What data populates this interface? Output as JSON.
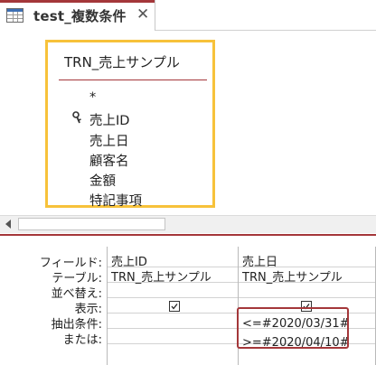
{
  "tab": {
    "title": "test_複数条件",
    "close_glyph": "✕"
  },
  "diagram": {
    "table_name": "TRN_売上サンプル",
    "fields": [
      "*",
      "売上ID",
      "売上日",
      "顧客名",
      "金額",
      "特記事項"
    ]
  },
  "grid": {
    "row_labels": [
      "フィールド:",
      "テーブル:",
      "並べ替え:",
      "表示:",
      "抽出条件:",
      "または:"
    ],
    "columns": [
      {
        "field": "売上ID",
        "table": "TRN_売上サンプル",
        "sort": "",
        "show": true,
        "criteria": "",
        "or": ""
      },
      {
        "field": "売上日",
        "table": "TRN_売上サンプル",
        "sort": "",
        "show": true,
        "criteria": "<=#2020/03/31#",
        "or": ">=#2020/04/10#"
      }
    ]
  },
  "colors": {
    "accent": "#a4373a",
    "table_selection": "#f7c23a"
  }
}
